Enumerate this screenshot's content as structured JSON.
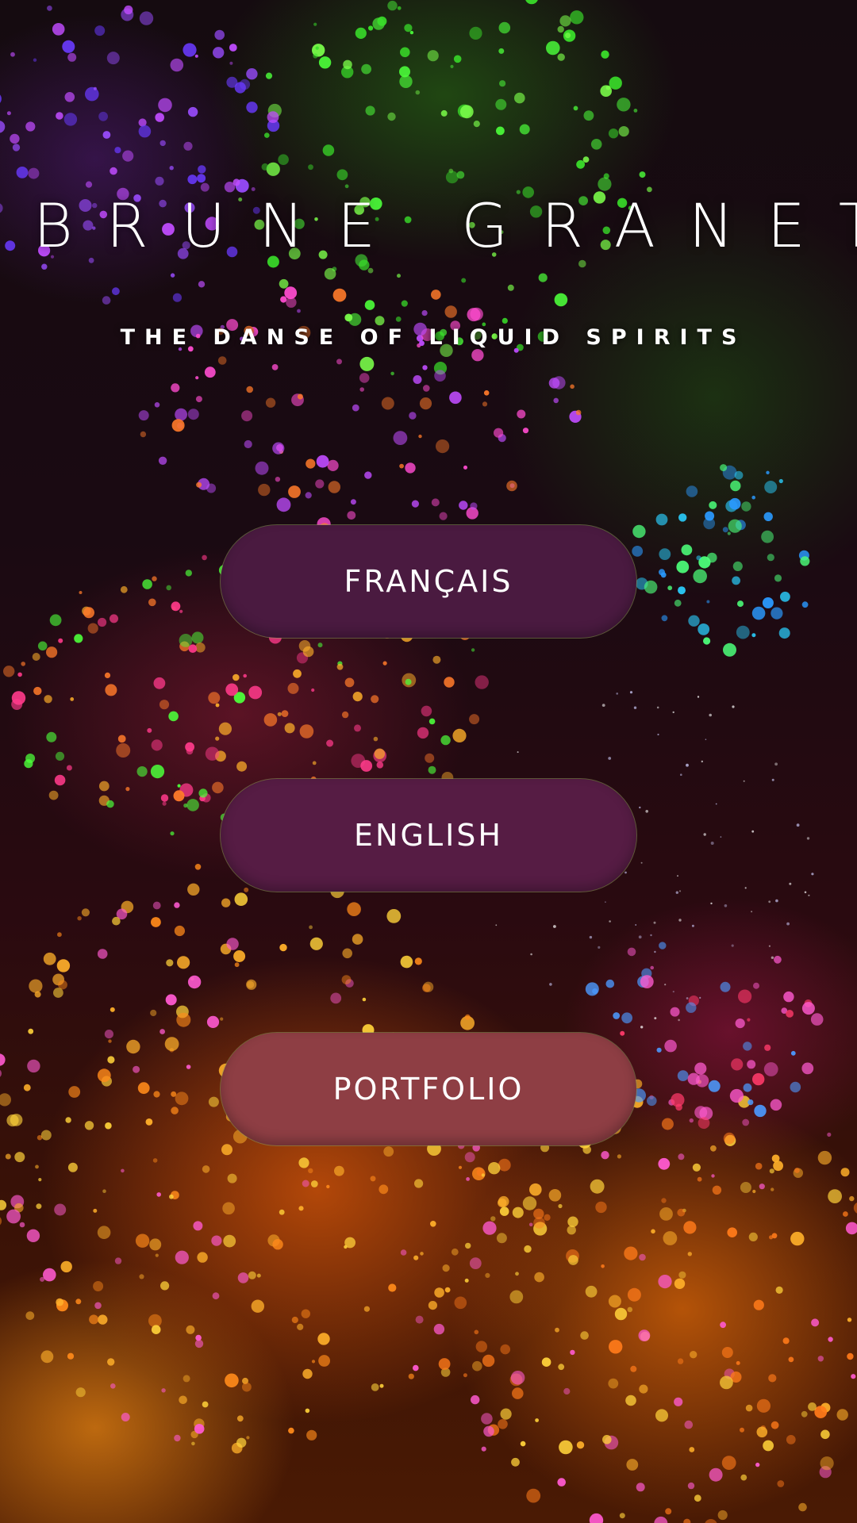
{
  "header": {
    "title": "BRUNE GRANET",
    "subtitle": "THE DANSE OF LIQUID SPIRITS"
  },
  "menu": {
    "french_label": "FRANÇAIS",
    "english_label": "ENGLISH",
    "portfolio_label": "PORTFOLIO"
  },
  "colors": {
    "button_french": "#4a1a40",
    "button_english": "#561c44",
    "button_portfolio": "#8e3e44",
    "text": "#ffffff"
  }
}
